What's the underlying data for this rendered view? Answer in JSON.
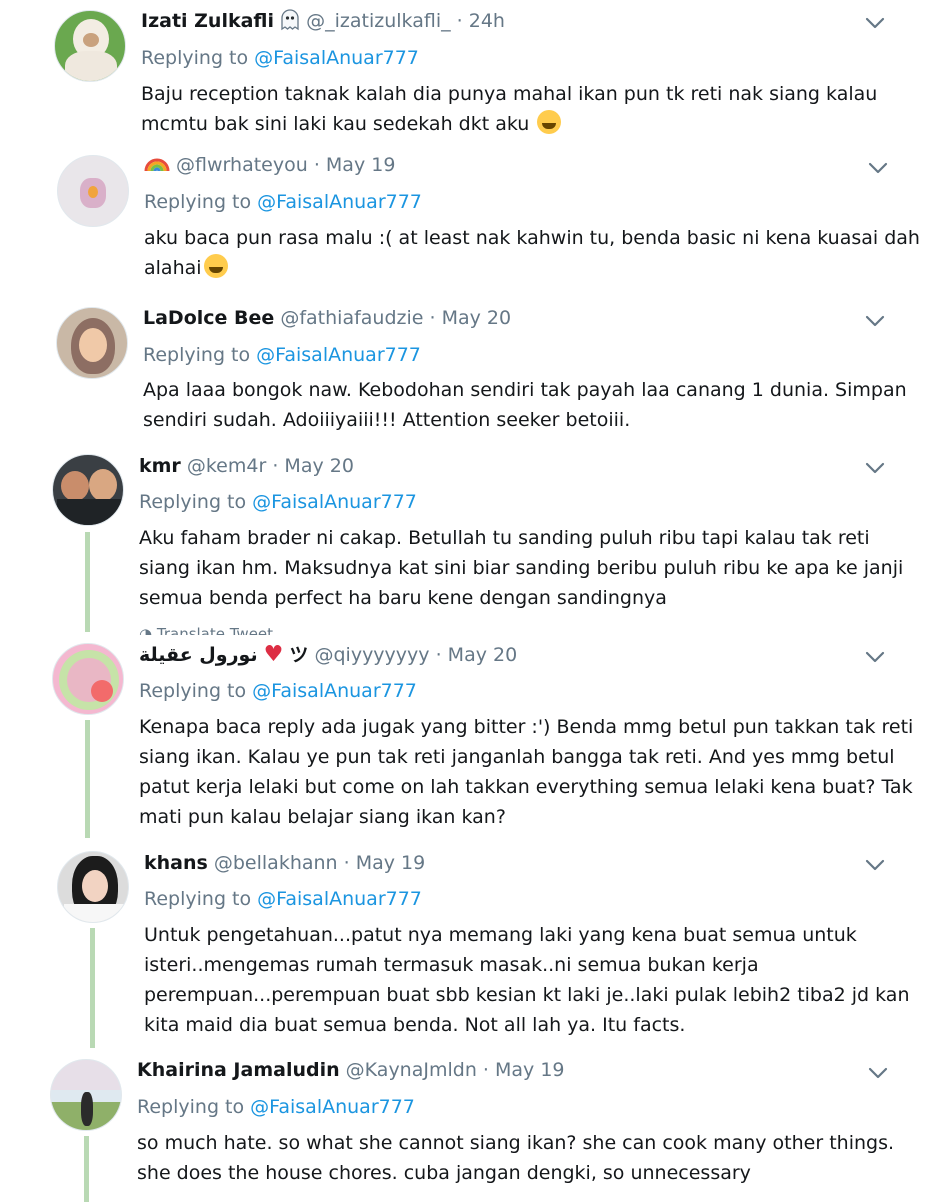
{
  "replies": [
    {
      "name": "Izati Zulkafli",
      "handle": "@_izatizulkafli_",
      "time": "· 24h",
      "replying_label": "Replying to",
      "replying_handle": "@FaisalAnuar777",
      "lines": [
        "Baju reception taknak kalah dia punya mahal ikan pun tk reti nak siang kalau",
        "mcmtu bak sini laki kau sedekah dkt aku"
      ],
      "emoji": "tears-of-joy-emoji"
    },
    {
      "name": "",
      "handle": "@flwrhateyou",
      "time": "· May 19",
      "replying_label": "Replying to",
      "replying_handle": "@FaisalAnuar777",
      "lines": [
        "aku baca pun rasa malu :( at least nak kahwin tu, benda basic ni kena kuasai dah",
        "alahai"
      ],
      "emoji": "sweat-smile-emoji"
    },
    {
      "name": "LaDolce Bee",
      "handle": "@fathiafaudzie",
      "time": "· May 20",
      "replying_label": "Replying to",
      "replying_handle": "@FaisalAnuar777",
      "lines": [
        "Apa laaa bongok naw. Kebodohan sendiri tak payah laa canang 1 dunia. Simpan",
        "sendiri sudah. Adoiiiyaiii!!! Attention seeker betoiii."
      ]
    },
    {
      "name": "kmr",
      "handle": "@kem4r",
      "time": "· May 20",
      "replying_label": "Replying to",
      "replying_handle": "@FaisalAnuar777",
      "lines": [
        "Aku faham brader ni cakap. Betullah tu sanding puluh ribu tapi kalau tak reti",
        "siang ikan hm. Maksudnya kat sini biar sanding beribu puluh ribu ke apa ke janji",
        "semua benda perfect ha baru kene dengan sandingnya"
      ],
      "translate": "Translate Tweet"
    },
    {
      "name": "نورول عقيلة",
      "name_suffix": "ツ",
      "handle": "@qiyyyyyyy",
      "time": "· May 20",
      "replying_label": "Replying to",
      "replying_handle": "@FaisalAnuar777",
      "lines": [
        "Kenapa baca reply ada jugak yang bitter :') Benda mmg betul pun takkan tak reti",
        "siang ikan. Kalau ye pun tak reti janganlah bangga tak reti. And yes mmg betul",
        "patut kerja lelaki but come on lah takkan everything semua lelaki kena buat? Tak",
        "mati pun kalau belajar siang ikan kan?"
      ]
    },
    {
      "name": "khans",
      "handle": "@bellakhann",
      "time": "· May 19",
      "replying_label": "Replying to",
      "replying_handle": "@FaisalAnuar777",
      "lines": [
        "Untuk pengetahuan...patut nya memang laki yang kena buat semua untuk",
        "isteri..mengemas rumah termasuk masak..ni semua bukan kerja",
        "perempuan...perempuan buat sbb kesian kt laki je..laki pulak lebih2 tiba2 jd kan",
        "kita maid dia buat semua benda. Not all lah ya. Itu facts."
      ]
    },
    {
      "name": "Khairina Jamaludin",
      "handle": "@KaynaJmldn",
      "time": "· May 19",
      "replying_label": "Replying to",
      "replying_handle": "@FaisalAnuar777",
      "lines": [
        "so much hate. so what she cannot siang ikan? she can cook many other things.",
        "she does the house chores. cuba jangan dengki, so unnecessary"
      ]
    }
  ],
  "icons": {
    "chevron": "chevron-down-icon",
    "ghost": "ghost-emoji",
    "rainbow": "rainbow-emoji",
    "heart": "red-heart-emoji"
  },
  "colors": {
    "link": "#1b95e0",
    "meta": "#657786",
    "thread": "#b9d9b4"
  }
}
